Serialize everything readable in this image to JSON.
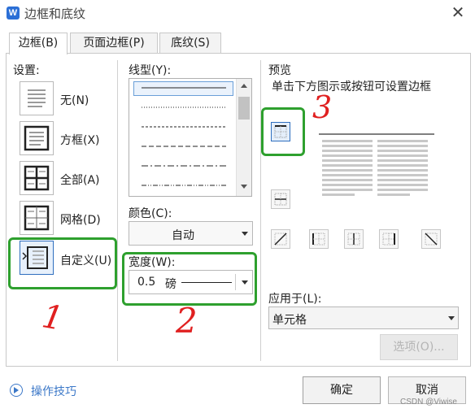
{
  "window": {
    "title": "边框和底纹",
    "app_icon_letter": "W"
  },
  "tabs": [
    {
      "label": "边框(B)",
      "active": true
    },
    {
      "label": "页面边框(P)",
      "active": false
    },
    {
      "label": "底纹(S)",
      "active": false
    }
  ],
  "settings": {
    "label": "设置:",
    "items": [
      {
        "label": "无(N)",
        "icon": "border-none-icon",
        "selected": false
      },
      {
        "label": "方框(X)",
        "icon": "border-box-icon",
        "selected": false
      },
      {
        "label": "全部(A)",
        "icon": "border-all-icon",
        "selected": false
      },
      {
        "label": "网格(D)",
        "icon": "border-grid-icon",
        "selected": false
      },
      {
        "label": "自定义(U)",
        "icon": "border-custom-icon",
        "selected": true
      }
    ]
  },
  "line_style": {
    "label": "线型(Y):"
  },
  "color": {
    "label": "颜色(C):",
    "value": "自动"
  },
  "width": {
    "label": "宽度(W):",
    "value": "0.5",
    "unit": "磅"
  },
  "preview": {
    "label": "预览",
    "hint": "单击下方图示或按钮可设置边框"
  },
  "apply_to": {
    "label": "应用于(L):",
    "value": "单元格"
  },
  "options_button": "选项(O)...",
  "tips_link": "操作技巧",
  "ok_button": "确定",
  "cancel_button": "取消",
  "watermark": "CSDN @Viwise",
  "annotations": {
    "n1": "1",
    "n2": "2",
    "n3": "3"
  },
  "colors": {
    "annotation_green": "#2ea02e",
    "annotation_red": "#e02020",
    "accent_blue": "#2f6fbf"
  }
}
